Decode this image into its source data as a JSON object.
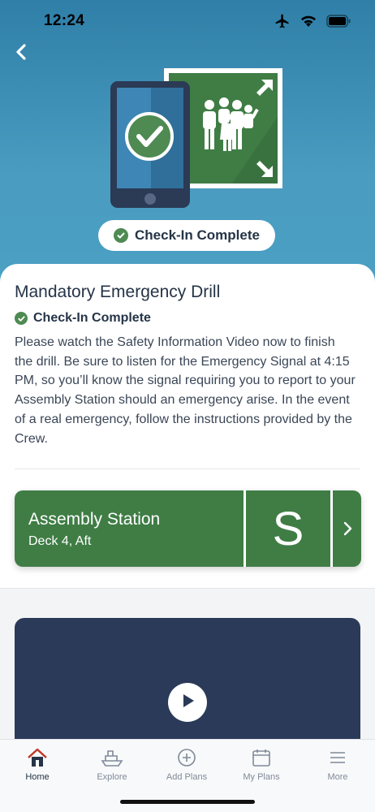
{
  "status_bar": {
    "time": "12:24"
  },
  "hero": {
    "checkin_pill_label": "Check-In Complete"
  },
  "drill": {
    "title": "Mandatory Emergency Drill",
    "status": "Check-In Complete",
    "description": "Please watch the Safety Information Video now to finish the drill. Be sure to listen for the Emergency Signal at 4:15 PM, so you’ll know the signal requiring you to report to your Assembly Station should an emergency arise. In the event of a real emergency, follow the instructions provided by the Crew."
  },
  "assembly": {
    "title": "Assembly Station",
    "location": "Deck 4, Aft",
    "station_letter": "S"
  },
  "tabs": [
    {
      "label": "Home",
      "icon": "house-icon",
      "active": true
    },
    {
      "label": "Explore",
      "icon": "ship-icon",
      "active": false
    },
    {
      "label": "Add Plans",
      "icon": "plus-circle-icon",
      "active": false
    },
    {
      "label": "My Plans",
      "icon": "calendar-icon",
      "active": false
    },
    {
      "label": "More",
      "icon": "menu-icon",
      "active": false
    }
  ],
  "colors": {
    "hero_blue": "#4a9cc0",
    "assembly_green": "#3f7d45",
    "check_green": "#4e8a52",
    "video_navy": "#2a3a58",
    "home_red": "#c0392b"
  }
}
